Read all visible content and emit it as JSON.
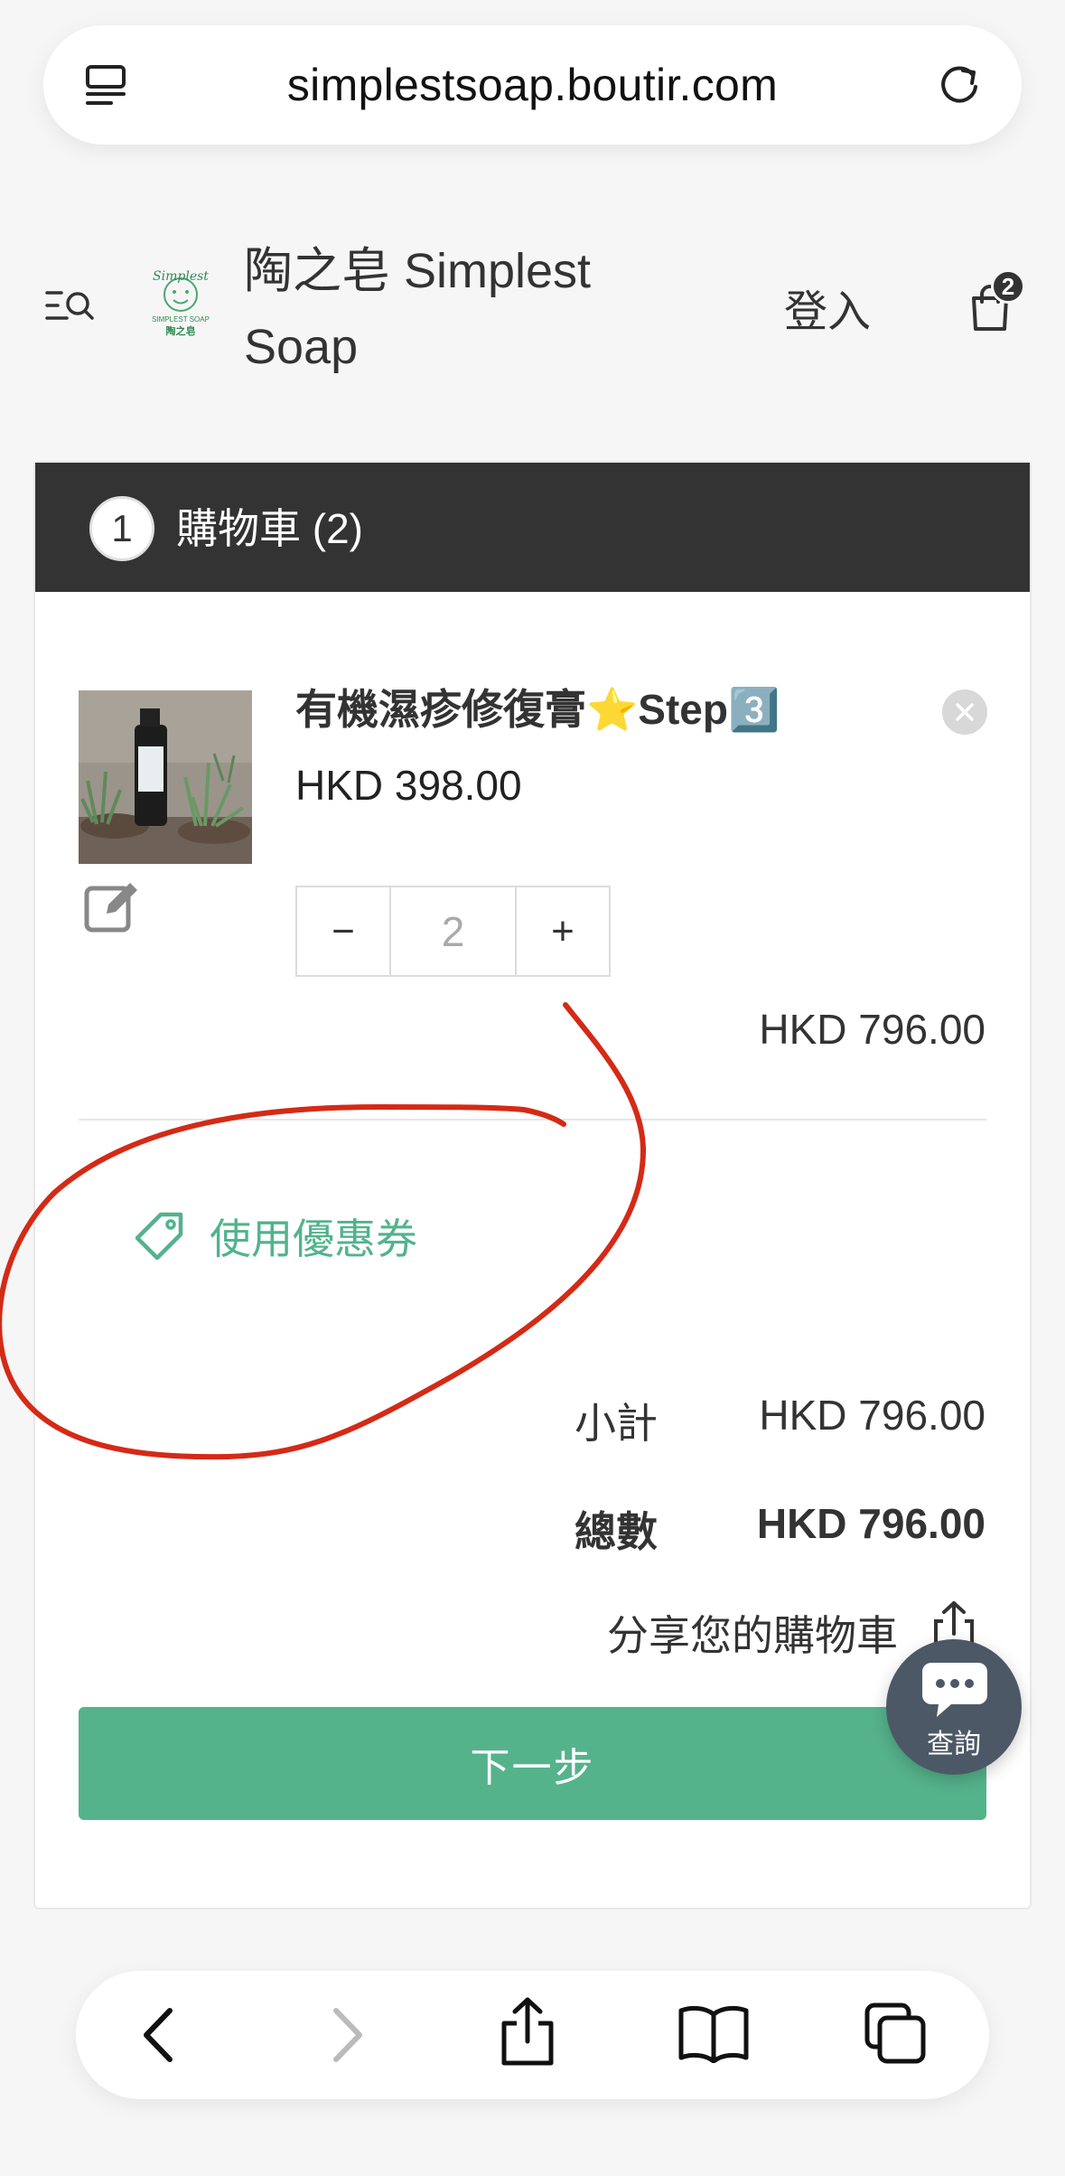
{
  "browser": {
    "url": "simplestsoap.boutir.com",
    "toolbar": {
      "back_icon": "chevron-left-icon",
      "forward_icon": "chevron-right-icon",
      "share_icon": "share-icon",
      "bookmarks_icon": "book-icon",
      "tabs_icon": "tabs-icon"
    }
  },
  "store": {
    "name": "陶之皂 Simplest Soap",
    "logo_text_top": "Simplest",
    "logo_text_mid": "SIMPLEST SOAP",
    "logo_text_bottom": "陶之皂",
    "login_label": "登入",
    "cart_count": "2"
  },
  "cart": {
    "step_number": "1",
    "title": "購物車 (2)",
    "item": {
      "name": "有機濕疹修復膏⭐Step3️⃣",
      "price": "HKD 398.00",
      "quantity": "2",
      "minus_label": "−",
      "plus_label": "+",
      "line_total": "HKD 796.00"
    },
    "coupon_label": "使用優惠券",
    "subtotal_label": "小計",
    "subtotal_value": "HKD 796.00",
    "total_label": "總數",
    "total_value": "HKD 796.00",
    "share_label": "分享您的購物車",
    "next_label": "下一步"
  },
  "chat": {
    "label": "查詢"
  },
  "colors": {
    "accent_green": "#55b38c",
    "header_dark": "#333333",
    "annotation_red": "#d42a16"
  }
}
